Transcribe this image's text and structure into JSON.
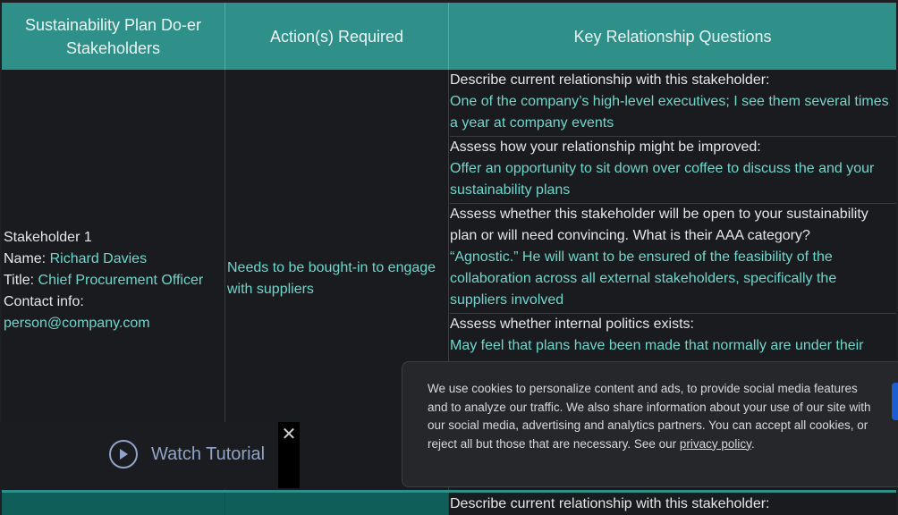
{
  "table": {
    "headers": [
      "Sustainability Plan Do-er Stakeholders",
      "Action(s) Required",
      "Key Relationship Questions"
    ],
    "stakeholder": {
      "heading": "Stakeholder 1",
      "name_label": "Name: ",
      "name_value": "Richard Davies",
      "title_label": "Title: ",
      "title_value": "Chief Procurement Officer",
      "contact_label": "Contact info:",
      "contact_value": "person@company.com"
    },
    "action": "Needs to be bought-in to engage with suppliers",
    "questions": [
      {
        "q": "Describe current relationship with this stakeholder:",
        "a": "One of the company’s high-level executives; I see them several times a year at company events"
      },
      {
        "q": "Assess how your relationship might be improved:",
        "a": "Offer an opportunity to sit down over coffee to discuss the and your sustainability plans"
      },
      {
        "q": "Assess whether this stakeholder will be open to your sustainability plan or will need convincing. What is their AAA category?",
        "a": "“Agnostic.” He will want to be ensured of the feasibility of the collaboration across all external stakeholders, specifically the suppliers involved"
      },
      {
        "q": "Assess whether internal politics exists:",
        "a": "May feel that plans have been made that normally are under their"
      }
    ],
    "next_row_question": "Describe current relationship with this stakeholder:"
  },
  "cookie_banner": {
    "text": "We use cookies to personalize content and ads, to provide social media features and to analyze our traffic. We also share information about your use of our site with our social media, advertising and analytics partners. You can accept all cookies, or reject all but those that are necessary. See our ",
    "link": "privacy policy",
    "end": "."
  },
  "tutorial": {
    "label": "Watch Tutorial",
    "icon": "play-icon",
    "close_icon": "close-icon",
    "close_glyph": "✕"
  },
  "colors": {
    "header_bg": "#2e9089",
    "accent_text": "#6fd6cc",
    "page_bg": "#1a1b1e"
  }
}
